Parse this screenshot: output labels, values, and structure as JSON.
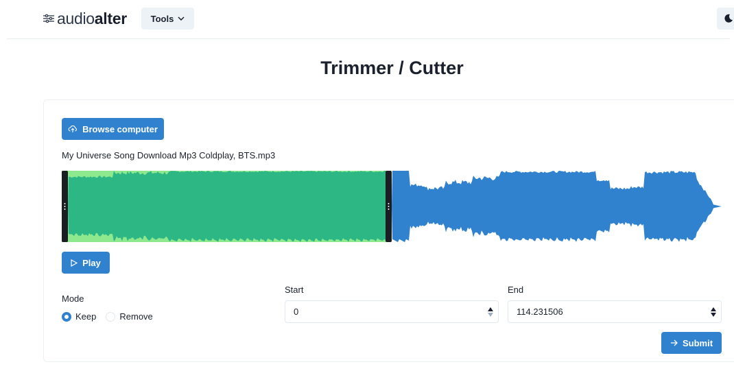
{
  "navbar": {
    "logo_regular": "audio",
    "logo_bold": "alter",
    "tools_label": "Tools",
    "logo_icon": "sliders-icon",
    "tools_icon": "chevron-down-icon",
    "theme_icon": "moon-icon"
  },
  "page": {
    "title": "Trimmer / Cutter"
  },
  "uploader": {
    "browse_label": "Browse computer",
    "browse_icon": "cloud-upload-icon",
    "file_name": "My Universe Song Download Mp3 Coldplay, BTS.mp3"
  },
  "waveform": {
    "selected_color": "#2db784",
    "selected_peak_color": "#8de88e",
    "unselected_color": "#3182ce",
    "handle_color": "#1a1d21",
    "selection_start_fraction": 0.0,
    "selection_end_fraction": 0.49
  },
  "player": {
    "play_label": "Play",
    "play_icon": "play-icon"
  },
  "mode": {
    "label": "Mode",
    "options": [
      {
        "label": "Keep",
        "checked": true
      },
      {
        "label": "Remove",
        "checked": false
      }
    ]
  },
  "range": {
    "start_label": "Start",
    "start_value": "0",
    "end_label": "End",
    "end_value": "114.231506"
  },
  "submit": {
    "label": "Submit",
    "icon": "arrow-right-icon"
  },
  "colors": {
    "accent": "#3182ce",
    "text": "#1a202c"
  }
}
